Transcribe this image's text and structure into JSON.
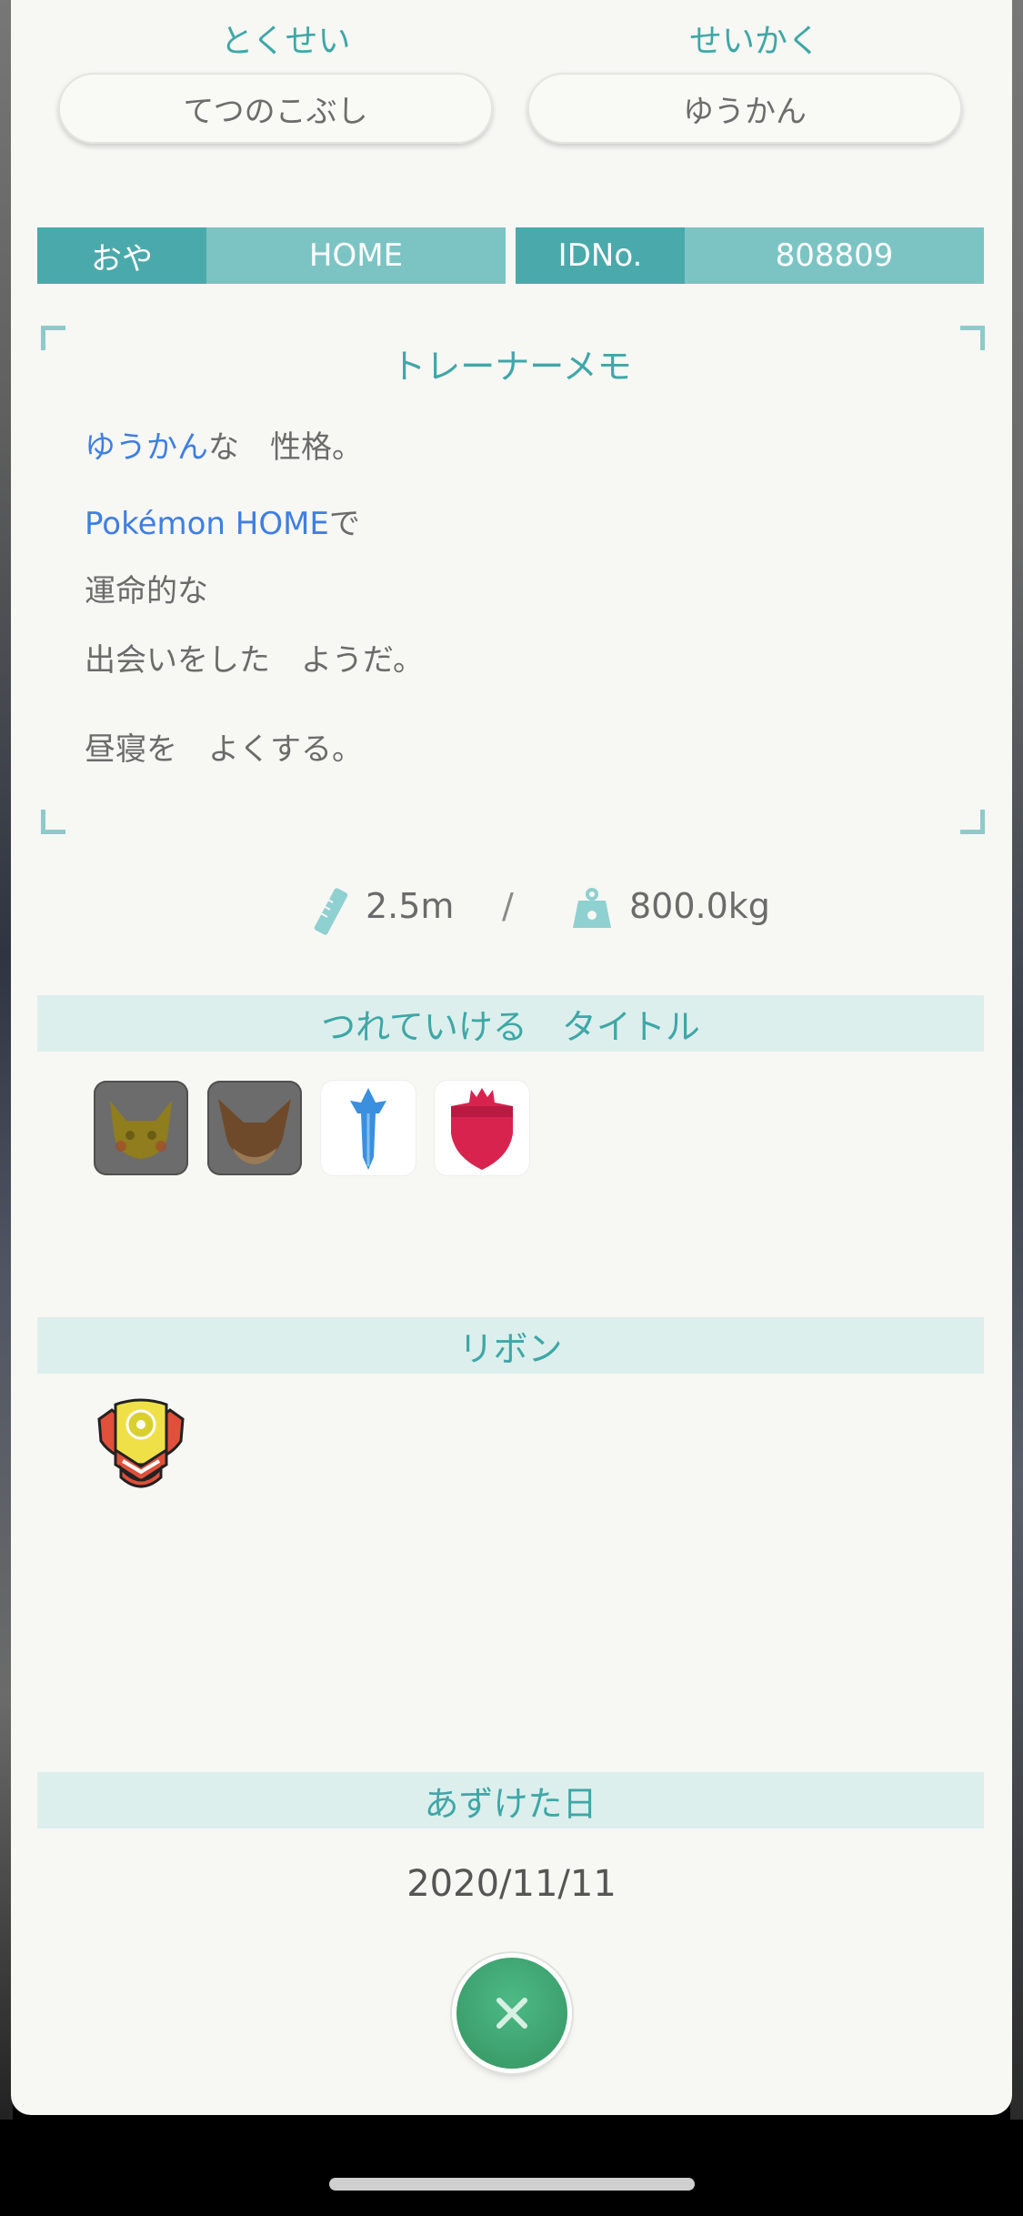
{
  "ability": {
    "label": "とくせい",
    "value": "てつのこぶし"
  },
  "nature": {
    "label": "せいかく",
    "value": "ゆうかん"
  },
  "ot": {
    "label": "おや",
    "value": "HOME"
  },
  "id": {
    "label": "IDNo.",
    "value": "808809"
  },
  "memo": {
    "title": "トレーナーメモ",
    "line1_highlight": "ゆうかん",
    "line1_rest": "な　性格。",
    "line2_highlight": "Pokémon HOME",
    "line2_rest": "で",
    "line3": "運命的な",
    "line4": "出会いをした　ようだ。",
    "line5": "昼寝を　よくする。"
  },
  "stats": {
    "height": "2.5m",
    "separator": "/",
    "weight": "800.0kg"
  },
  "titles": {
    "header": "つれていける　タイトル",
    "icons": [
      "pikachu-title-icon",
      "eevee-title-icon",
      "sword-title-icon",
      "shield-title-icon"
    ]
  },
  "ribbons": {
    "header": "リボン",
    "icons": [
      "home-ribbon-icon"
    ]
  },
  "deposited": {
    "header": "あずけた日",
    "date": "2020/11/11"
  },
  "close": {
    "symbol": "×"
  },
  "colors": {
    "teal": "#3fa7a7",
    "idbar_dark": "#4aa9ab",
    "idbar_light": "#7cc4c4",
    "band": "#dcefed",
    "highlight_blue": "#3f7fe0",
    "close_green": "#3a9d6a"
  }
}
